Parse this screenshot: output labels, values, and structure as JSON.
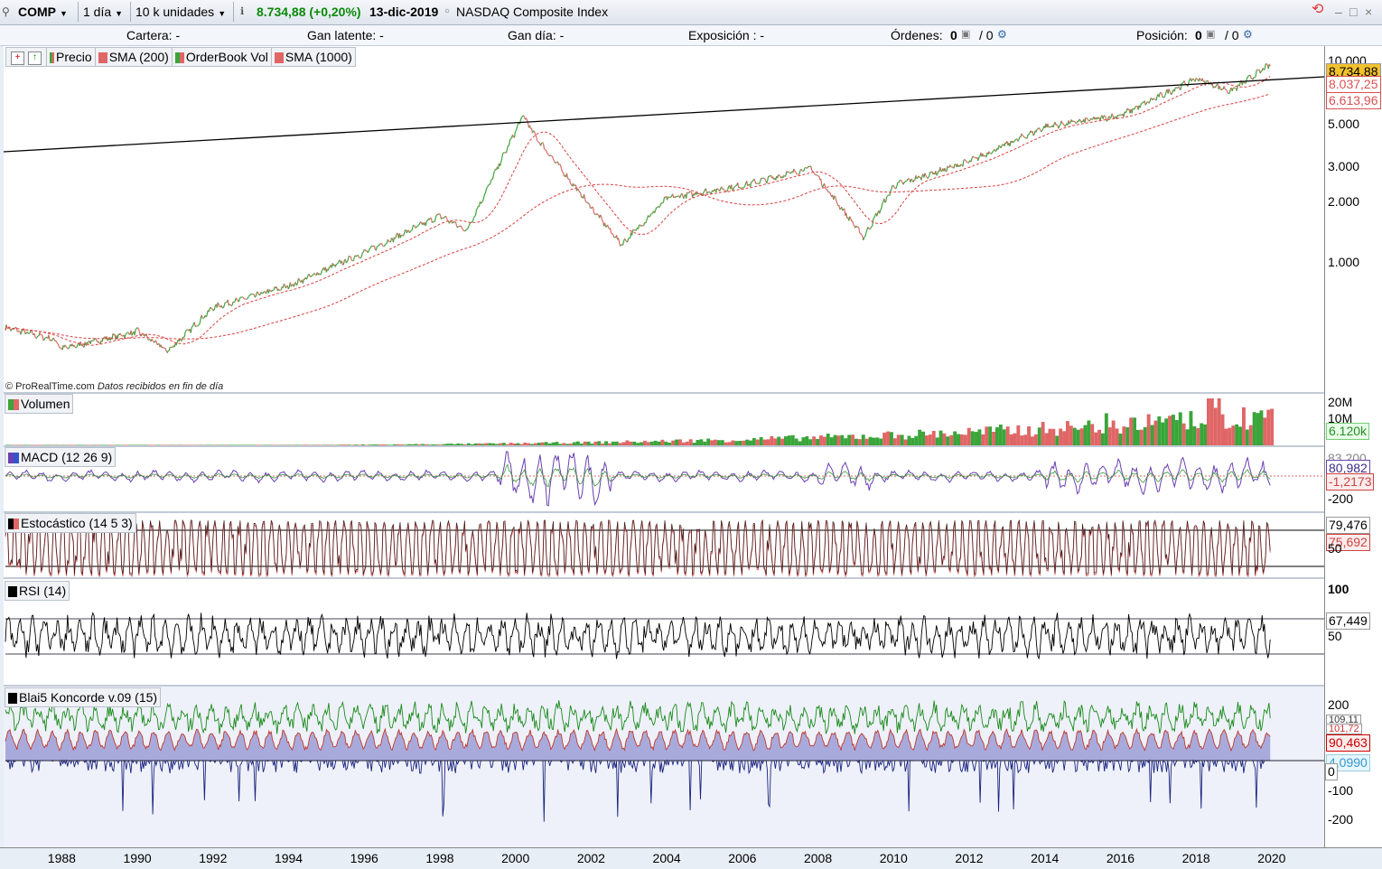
{
  "toolbar": {
    "symbol": "COMP",
    "period": "1 día",
    "units": "10 k unidades",
    "info_icon": "info-icon",
    "price": "8.734,88 (+0,20%)",
    "date": "13-dic-2019",
    "instrument": "NASDAQ Composite Index"
  },
  "infobar": {
    "cartera": "Cartera: -",
    "gan_latente": "Gan latente: -",
    "gan_dia": "Gan día: -",
    "exposicion": "Exposición : -",
    "ordenes_label": "Órdenes:",
    "ordenes_a": "0",
    "ordenes_b": "/ 0",
    "posicion_label": "Posición:",
    "posicion_a": "0",
    "posicion_b": "/ 0"
  },
  "legends": {
    "precio": "Precio",
    "sma200": "SMA (200)",
    "orderbook": "OrderBook Vol",
    "sma1000": "SMA (1000)",
    "volumen": "Volumen",
    "macd": "MACD (12 26 9)",
    "estocastico": "Estocástico (14 5 3)",
    "rsi": "RSI (14)",
    "koncorde": "Blai5 Koncorde v.09 (15)"
  },
  "credit": {
    "site": "© ProRealTime.com",
    "note": "Datos recibidos en fin de día"
  },
  "price_axis": [
    "10.000",
    "5.000",
    "3.000",
    "2.000",
    "1.000"
  ],
  "price_tags": {
    "last": "8.734,88",
    "sma200": "8.037,25",
    "sma1000": "6.613,96"
  },
  "volume_axis": [
    "20M",
    "10M"
  ],
  "volume_tag": "6.120k",
  "macd_axis": [
    "-200"
  ],
  "macd_tags": {
    "top": "83,200",
    "macd": "80,982",
    "signal": "-1,2173"
  },
  "stoch_tags": {
    "k": "79,476",
    "d": "75,692",
    "lvl": "50"
  },
  "rsi_axis": {
    "top": "100",
    "mid": "50"
  },
  "rsi_tag": "67,449",
  "koncorde_axis": [
    "200",
    "-100",
    "-200"
  ],
  "koncorde_tags": {
    "a": "109,11",
    "b": "101,72",
    "c": "90,463",
    "d": "4,0990",
    "zero": "0"
  },
  "x_axis": [
    "1988",
    "1990",
    "1992",
    "1994",
    "1996",
    "1998",
    "2000",
    "2002",
    "2004",
    "2006",
    "2008",
    "2010",
    "2012",
    "2014",
    "2016",
    "2018",
    "2020"
  ],
  "colors": {
    "up": "#3aa53a",
    "down": "#e06666",
    "sma": "#d94040",
    "trend": "#000000",
    "macd": "#6a3fb0",
    "koncorde_green": "#1a8a1a",
    "koncorde_red": "#c0392b",
    "koncorde_blue": "#1a237e",
    "koncorde_fill": "#8c8ccf"
  },
  "chart_data": {
    "type": "line",
    "title": "NASDAQ Composite Index",
    "scale": "log",
    "ylim": [
      400,
      11000
    ],
    "x": [
      1986.5,
      1987.8,
      1988,
      1990,
      1990.8,
      1992,
      1994,
      1996,
      1998,
      1998.7,
      2000.2,
      2000.5,
      2002,
      2002.8,
      2004,
      2006,
      2007.8,
      2009.2,
      2010,
      2012,
      2014,
      2016,
      2018,
      2018.9,
      2019.95
    ],
    "series": [
      {
        "name": "Precio",
        "values": [
          480,
          420,
          380,
          460,
          370,
          600,
          760,
          1100,
          1650,
          1400,
          5000,
          4000,
          1800,
          1200,
          2000,
          2300,
          2800,
          1300,
          2300,
          3000,
          4400,
          5000,
          7500,
          6500,
          8734.88
        ]
      }
    ]
  }
}
